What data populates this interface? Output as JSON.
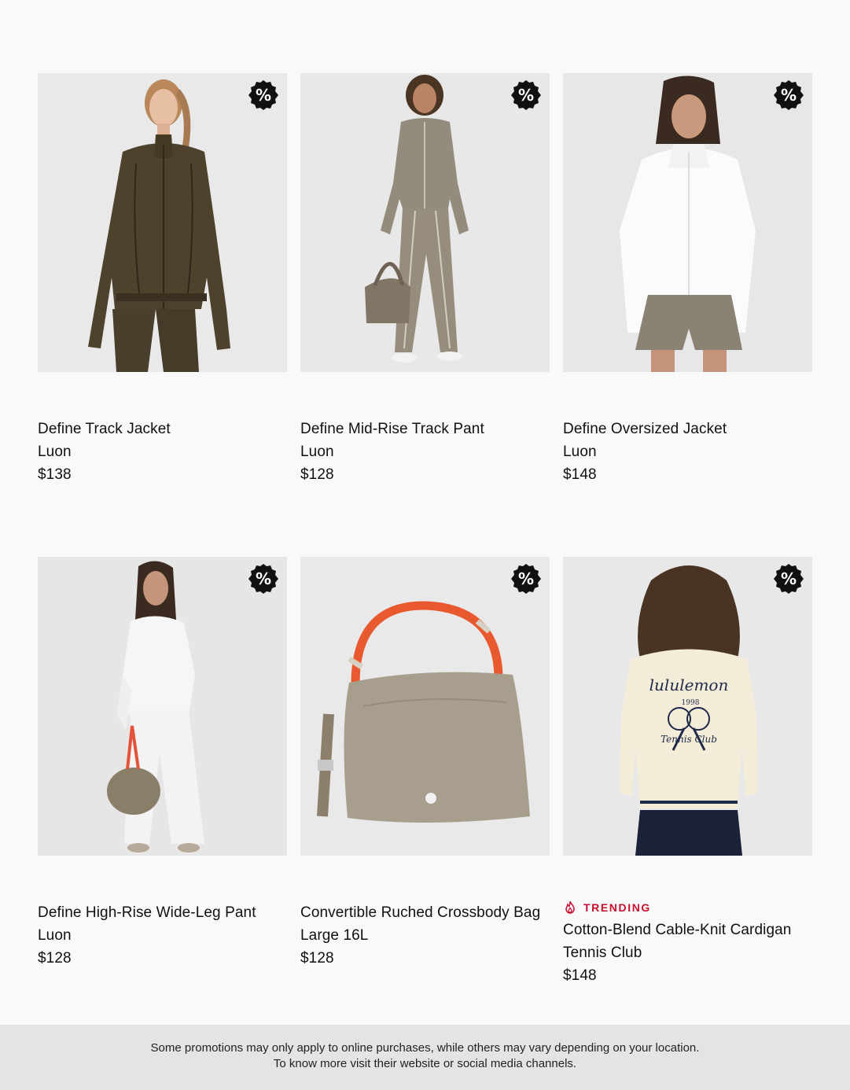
{
  "badge_symbol": "%",
  "colors": {
    "background": "#f9f9f9",
    "trending": "#c8102e",
    "footer_bg": "#e4e4e4",
    "badge": "#111111"
  },
  "products": [
    {
      "name": "Define Track Jacket",
      "sub": "Luon",
      "price": "$138",
      "image": "olive zip jacket on model"
    },
    {
      "name": "Define Mid-Rise Track Pant",
      "sub": "Luon",
      "price": "$128",
      "image": "taupe tracksuit with duffel bag"
    },
    {
      "name": "Define Oversized Jacket",
      "sub": "Luon",
      "price": "$148",
      "image": "white oversized jacket with shorts"
    },
    {
      "name": "Define High-Rise Wide-Leg Pant",
      "sub": "Luon",
      "price": "$128",
      "image": "white wide-leg pant outfit"
    },
    {
      "name": "Convertible Ruched Crossbody Bag",
      "sub": "Large 16L",
      "price": "$128",
      "image": "taupe crossbody bag with orange handle"
    },
    {
      "name": "Cotton-Blend Cable-Knit Cardigan",
      "sub": "Tennis Club",
      "price": "$148",
      "image": "cream cable-knit cardigan back view",
      "tag": "TRENDING"
    }
  ],
  "cardigan_print": {
    "brand": "lululemon",
    "year": "1998",
    "club": "Tennis Club"
  },
  "footer": {
    "line1": "Some promotions may only apply to online purchases, while others may vary depending on your location.",
    "line2": "To know more visit their website or social media channels."
  }
}
